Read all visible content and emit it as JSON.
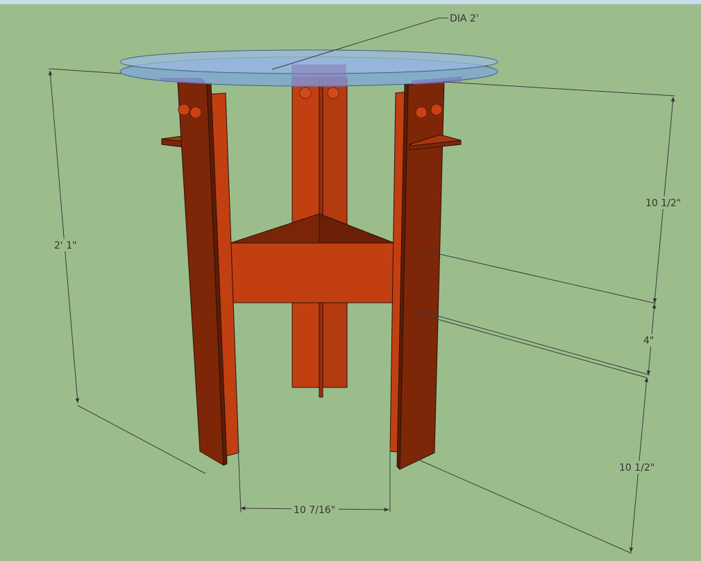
{
  "dimensions": {
    "top_diameter": "DIA 2'",
    "overall_height": "2' 1\"",
    "upper_segment": "10 1/2\"",
    "middle_segment": "4\"",
    "lower_segment": "10 1/2\"",
    "leg_spacing": "10 7/16\""
  },
  "colors": {
    "background": "#9bbd8c",
    "wood_light": "#c23f12",
    "wood_dark": "#7d2608",
    "glass": "#7fa6d6"
  }
}
